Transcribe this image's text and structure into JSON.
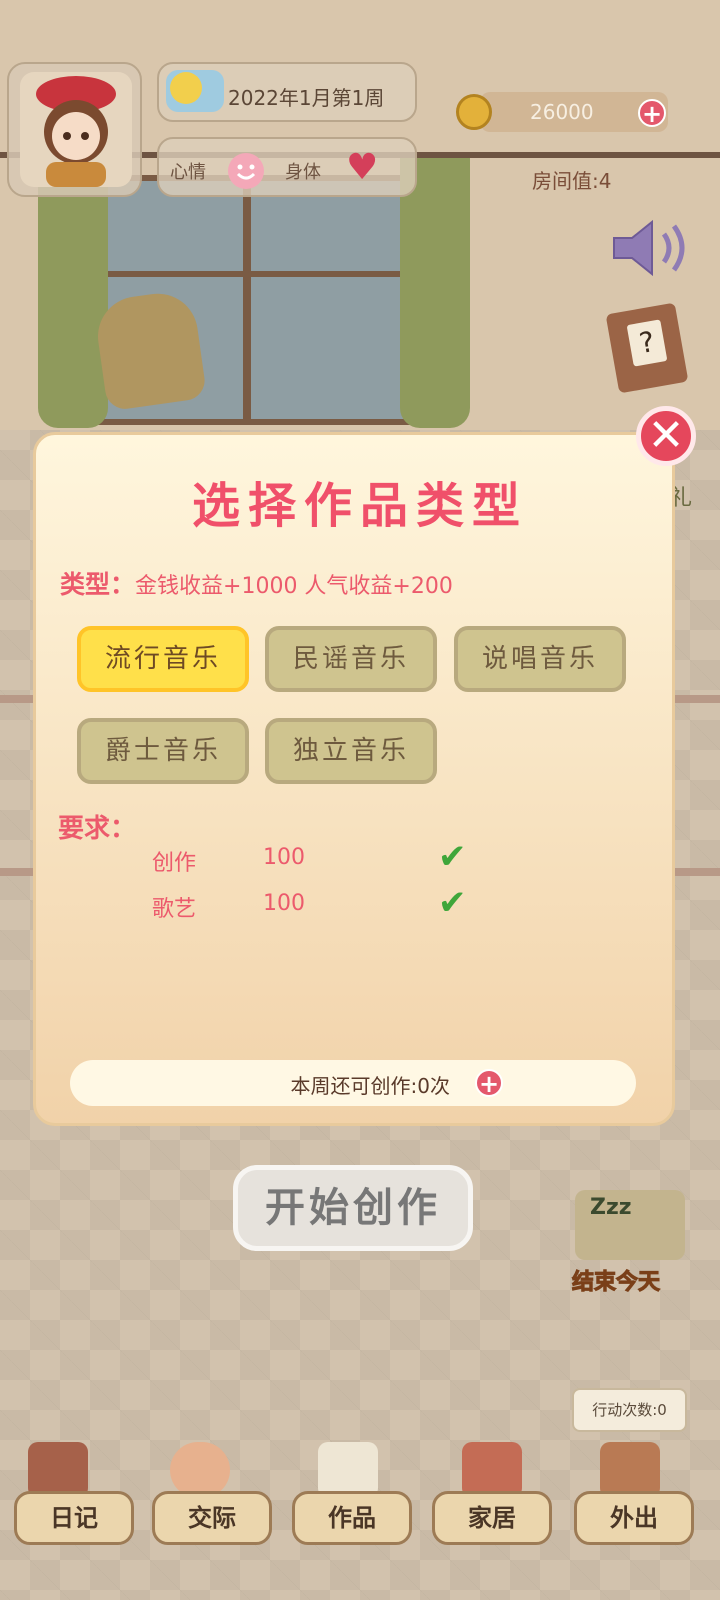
{
  "hud": {
    "date": "2022年1月第1周",
    "mood_label": "心情",
    "body_label": "身体",
    "money": "26000",
    "money_plus": "+",
    "room_value": "房间值:4"
  },
  "side": {
    "gift_fragment": "礼",
    "help_mark": "?"
  },
  "modal": {
    "title": "选择作品类型",
    "close_symbol": "✕",
    "type_prefix": "类型：",
    "type_effect": "金钱收益+1000  人气收益+200",
    "genres": [
      "流行音乐",
      "民谣音乐",
      "说唱音乐",
      "爵士音乐",
      "独立音乐"
    ],
    "selected_genre": "流行音乐",
    "requirements_label": "要求：",
    "requirements": [
      {
        "name": "创作",
        "value": "100",
        "met": "✔"
      },
      {
        "name": "歌艺",
        "value": "100",
        "met": "✔"
      }
    ],
    "weekly_quota": "本周还可创作:0次",
    "quota_plus": "+"
  },
  "start_button": "开始创作",
  "end_day": {
    "zzz": "Zzz",
    "label": "结束今天"
  },
  "actions_left": "行动次数:0",
  "nav": [
    "日记",
    "交际",
    "作品",
    "家居",
    "外出"
  ],
  "colors": {
    "accent_red": "#f0506a",
    "selected_yellow": "#ffe04a",
    "check_green": "#3fa63a"
  }
}
